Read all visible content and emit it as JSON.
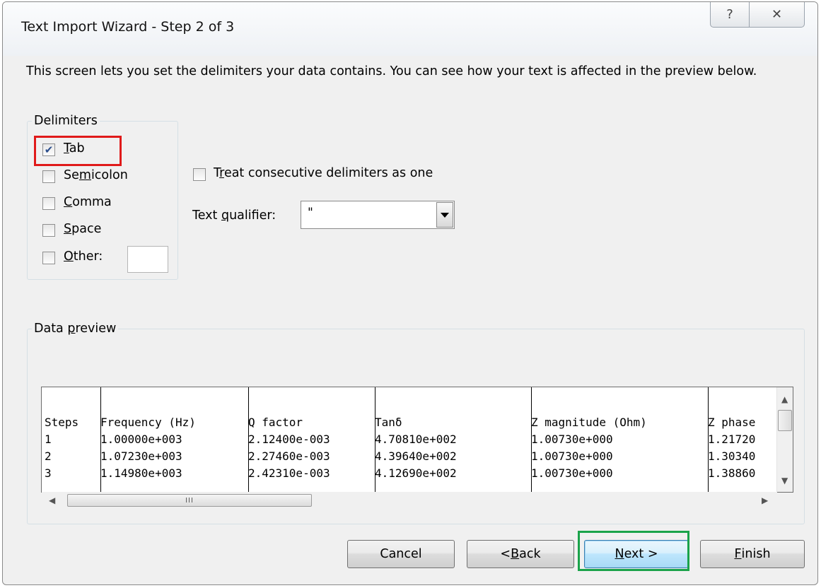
{
  "window": {
    "title": "Text Import Wizard - Step 2 of 3",
    "help_glyph": "?",
    "close_glyph": "✕"
  },
  "intro": "This screen lets you set the delimiters your data contains.  You can see how your text is affected in the preview below.",
  "delimiters": {
    "legend": "Delimiters",
    "tab": {
      "label_pre": "",
      "label_u": "T",
      "label_post": "ab",
      "checked": true
    },
    "semicolon": {
      "label_pre": "Se",
      "label_u": "m",
      "label_post": "icolon",
      "checked": false
    },
    "comma": {
      "label_pre": "",
      "label_u": "C",
      "label_post": "omma",
      "checked": false
    },
    "space": {
      "label_pre": "",
      "label_u": "S",
      "label_post": "pace",
      "checked": false
    },
    "other": {
      "label_pre": "",
      "label_u": "O",
      "label_post": "ther:",
      "checked": false,
      "value": ""
    }
  },
  "consecutive": {
    "label_pre": "T",
    "label_u": "r",
    "label_post": "eat consecutive delimiters as one",
    "checked": false
  },
  "qualifier": {
    "label_pre": "Text ",
    "label_u": "q",
    "label_post": "ualifier:",
    "value": "\""
  },
  "preview": {
    "legend_pre": "Data ",
    "legend_u": "p",
    "legend_post": "review",
    "rows": [
      [
        "Steps",
        "Frequency (Hz)",
        "Q factor",
        "Tanδ",
        "Z magnitude (Ohm)",
        "Z phase"
      ],
      [
        "1",
        "1.00000e+003",
        "2.12400e-003",
        "4.70810e+002",
        "1.00730e+000",
        "1.21720"
      ],
      [
        "2",
        "1.07230e+003",
        "2.27460e-003",
        "4.39640e+002",
        "1.00730e+000",
        "1.30340"
      ],
      [
        "3",
        "1.14980e+003",
        "2.42310e-003",
        "4.12690e+002",
        "1.00730e+000",
        "1.38860"
      ]
    ],
    "scroll_grip": "III"
  },
  "buttons": {
    "cancel": "Cancel",
    "back_pre": "< ",
    "back_u": "B",
    "back_post": "ack",
    "next_pre": "",
    "next_u": "N",
    "next_post": "ext >",
    "finish_pre": "",
    "finish_u": "F",
    "finish_post": "inish"
  }
}
